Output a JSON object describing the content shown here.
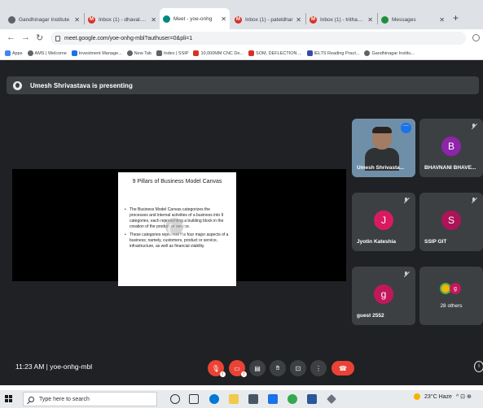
{
  "browser": {
    "tabs": [
      {
        "label": "Gandhinagar Institute",
        "icon": "school-favicon",
        "color": "#5f6368",
        "active": false
      },
      {
        "label": "Inbox (1) - dhaval.pan",
        "icon": "gmail-favicon",
        "color": "#d93025",
        "active": false
      },
      {
        "label": "Meet - yoe-onhg",
        "icon": "meet-favicon",
        "color": "#00897b",
        "active": true
      },
      {
        "label": "Inbox (1) - pateldhar",
        "icon": "gmail-favicon",
        "color": "#d93025",
        "active": false
      },
      {
        "label": "Inbox (1) - trithaksh",
        "icon": "gmail-favicon",
        "color": "#d93025",
        "active": false
      },
      {
        "label": "Messages",
        "icon": "messages-favicon",
        "color": "#1e8e3e",
        "active": false
      }
    ],
    "url": "meet.google.com/yoe-onhg-mbl?authuser=0&pli=1",
    "bookmarks": [
      {
        "label": "Apps",
        "color": "#4285f4"
      },
      {
        "label": "AMS | Welcome",
        "color": "#5f6368"
      },
      {
        "label": "Investment Manage...",
        "color": "#1a73e8"
      },
      {
        "label": "New Tab",
        "color": "#5f6368"
      },
      {
        "label": "Index | SSIP",
        "color": "#5f6368"
      },
      {
        "label": "10,000MM CNC De...",
        "color": "#d93025"
      },
      {
        "label": "SOM, DEFLECTION ...",
        "color": "#d93025"
      },
      {
        "label": "IELTS Reading Pract...",
        "color": "#3949ab"
      },
      {
        "label": "Gandhinagar Institu...",
        "color": "#5f6368"
      }
    ]
  },
  "meet": {
    "presenting_text": "Umesh Shrivastava is presenting",
    "slide": {
      "title": "9 Pillars of Business Model Canvas",
      "bullets": [
        "The Business Model Canvas categorizes the processes and internal activities of a business into 9 categories, each representing a building block in the creation of the product or service.",
        "These categories represent the four major aspects of a business; namely, customers, product or service, infrastructure, as well as financial viability."
      ]
    },
    "participants": [
      {
        "name": "Umesh Shrivasta...",
        "type": "video"
      },
      {
        "name": "BHAVNANI BHAVE...",
        "initial": "B",
        "color": "#8e24aa"
      },
      {
        "name": "Jyotin Kateshia",
        "initial": "J",
        "color": "#d81b60"
      },
      {
        "name": "SSIP GIT",
        "initial": "S",
        "color": "#ad1457"
      },
      {
        "name": "guest 2552",
        "initial": "g",
        "color": "#c2185b"
      },
      {
        "name": "28 others",
        "initial": "g",
        "color": "#c2185b"
      }
    ],
    "meeting_info": "11:23 AM  |  yoe-onhg-mbl",
    "controls": {
      "mic_badge": "!",
      "cam_badge": "!",
      "more_dots": "⋯",
      "info": "i"
    }
  },
  "taskbar": {
    "search_placeholder": "Type here to search",
    "weather": "23°C Haze",
    "tray_icons": "^ ⊡ ⊕"
  }
}
